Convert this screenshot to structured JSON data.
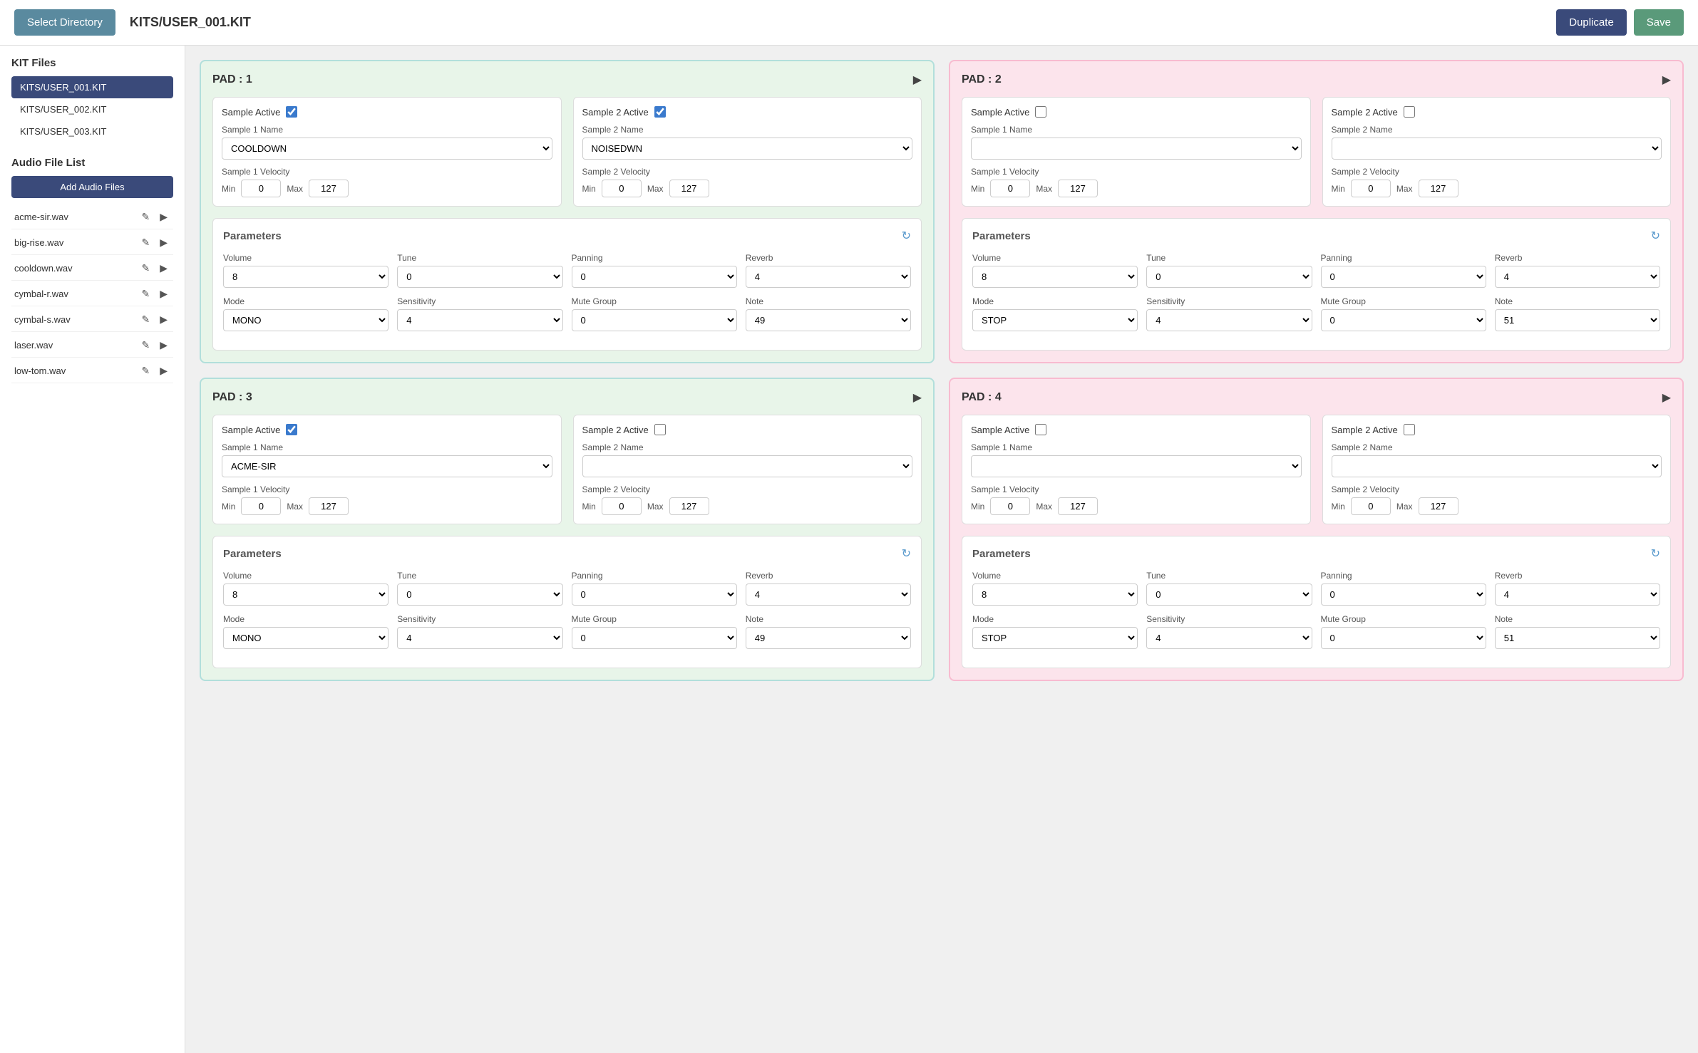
{
  "topbar": {
    "select_dir_label": "Select Directory",
    "kit_path": "KITS/USER_001.KIT",
    "duplicate_label": "Duplicate",
    "save_label": "Save"
  },
  "sidebar": {
    "kit_files_title": "KIT Files",
    "kit_files": [
      {
        "name": "KITS/USER_001.KIT",
        "active": true
      },
      {
        "name": "KITS/USER_002.KIT",
        "active": false
      },
      {
        "name": "KITS/USER_003.KIT",
        "active": false
      }
    ],
    "audio_files_title": "Audio File List",
    "add_audio_label": "Add Audio Files",
    "audio_files": [
      "acme-sir.wav",
      "big-rise.wav",
      "cooldown.wav",
      "cymbal-r.wav",
      "cymbal-s.wav",
      "laser.wav",
      "low-tom.wav"
    ]
  },
  "pads": [
    {
      "id": "pad1",
      "title": "PAD : 1",
      "theme": "green",
      "sample1": {
        "active": true,
        "active_label": "Sample Active",
        "name_label": "Sample 1 Name",
        "name_value": "COOLDOWN",
        "velocity_label": "Sample 1 Velocity",
        "vel_min": "0",
        "vel_max": "127"
      },
      "sample2": {
        "active": true,
        "active_label": "Sample 2 Active",
        "name_label": "Sample 2 Name",
        "name_value": "NOISEDWN",
        "velocity_label": "Sample 2 Velocity",
        "vel_min": "0",
        "vel_max": "127"
      },
      "params": {
        "title": "Parameters",
        "volume": "8",
        "tune": "0",
        "panning": "0",
        "reverb": "4",
        "mode": "MONO",
        "sensitivity": "4",
        "mute_group": "0",
        "note": "49"
      }
    },
    {
      "id": "pad2",
      "title": "PAD : 2",
      "theme": "pink",
      "sample1": {
        "active": false,
        "active_label": "Sample Active",
        "name_label": "Sample 1 Name",
        "name_value": "",
        "velocity_label": "Sample 1 Velocity",
        "vel_min": "0",
        "vel_max": "127"
      },
      "sample2": {
        "active": false,
        "active_label": "Sample 2 Active",
        "name_label": "Sample 2 Name",
        "name_value": "",
        "velocity_label": "Sample 2 Velocity",
        "vel_min": "0",
        "vel_max": "127"
      },
      "params": {
        "title": "Parameters",
        "volume": "8",
        "tune": "0",
        "panning": "0",
        "reverb": "4",
        "mode": "STOP",
        "sensitivity": "4",
        "mute_group": "0",
        "note": "51"
      }
    },
    {
      "id": "pad3",
      "title": "PAD : 3",
      "theme": "green",
      "sample1": {
        "active": true,
        "active_label": "Sample Active",
        "name_label": "Sample 1 Name",
        "name_value": "ACME-SIR",
        "velocity_label": "Sample 1 Velocity",
        "vel_min": "0",
        "vel_max": "127"
      },
      "sample2": {
        "active": false,
        "active_label": "Sample 2 Active",
        "name_label": "Sample 2 Name",
        "name_value": "",
        "velocity_label": "Sample 2 Velocity",
        "vel_min": "0",
        "vel_max": "127"
      },
      "params": {
        "title": "Parameters",
        "volume": "8",
        "tune": "0",
        "panning": "0",
        "reverb": "4",
        "mode": "MONO",
        "sensitivity": "4",
        "mute_group": "0",
        "note": "49"
      }
    },
    {
      "id": "pad4",
      "title": "PAD : 4",
      "theme": "pink",
      "sample1": {
        "active": false,
        "active_label": "Sample Active",
        "name_label": "Sample 1 Name",
        "name_value": "",
        "velocity_label": "Sample 1 Velocity",
        "vel_min": "0",
        "vel_max": "127"
      },
      "sample2": {
        "active": false,
        "active_label": "Sample 2 Active",
        "name_label": "Sample 2 Name",
        "name_value": "",
        "velocity_label": "Sample 2 Velocity",
        "vel_min": "0",
        "vel_max": "127"
      },
      "params": {
        "title": "Parameters",
        "volume": "8",
        "tune": "0",
        "panning": "0",
        "reverb": "4",
        "mode": "STOP",
        "sensitivity": "4",
        "mute_group": "0",
        "note": "51"
      }
    }
  ],
  "labels": {
    "volume": "Volume",
    "tune": "Tune",
    "panning": "Panning",
    "reverb": "Reverb",
    "mode": "Mode",
    "sensitivity": "Sensitivity",
    "mute_group": "Mute Group",
    "note": "Note",
    "min": "Min",
    "max": "Max"
  }
}
